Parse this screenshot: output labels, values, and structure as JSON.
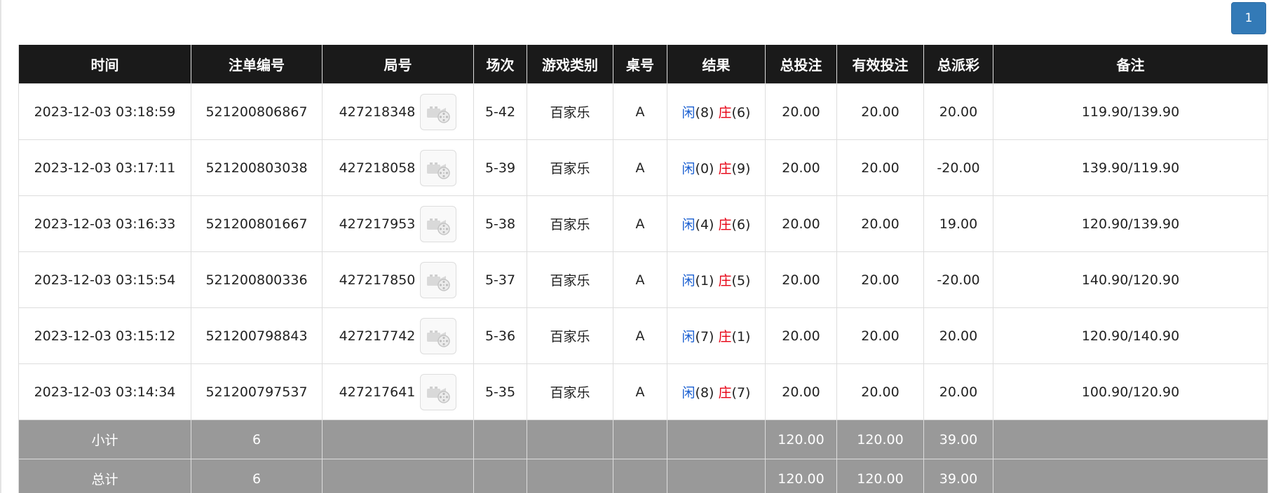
{
  "pagination": {
    "current_page": "1"
  },
  "table": {
    "headers": [
      "时间",
      "注单编号",
      "局号",
      "场次",
      "游戏类别",
      "桌号",
      "结果",
      "总投注",
      "有效投注",
      "总派彩",
      "备注"
    ],
    "rows": [
      {
        "time": "2023-12-03 03:18:59",
        "bet_id": "521200806867",
        "round_id": "427218348",
        "session": "5-42",
        "game": "百家乐",
        "table": "A",
        "player_label": "闲",
        "player_score": "(8)",
        "banker_label": "庄",
        "banker_score": "(6)",
        "total_bet": "20.00",
        "valid_bet": "20.00",
        "payout": "20.00",
        "payout_negative": false,
        "remark": "119.90/139.90"
      },
      {
        "time": "2023-12-03 03:17:11",
        "bet_id": "521200803038",
        "round_id": "427218058",
        "session": "5-39",
        "game": "百家乐",
        "table": "A",
        "player_label": "闲",
        "player_score": "(0)",
        "banker_label": "庄",
        "banker_score": "(9)",
        "total_bet": "20.00",
        "valid_bet": "20.00",
        "payout": "-20.00",
        "payout_negative": true,
        "remark": "139.90/119.90"
      },
      {
        "time": "2023-12-03 03:16:33",
        "bet_id": "521200801667",
        "round_id": "427217953",
        "session": "5-38",
        "game": "百家乐",
        "table": "A",
        "player_label": "闲",
        "player_score": "(4)",
        "banker_label": "庄",
        "banker_score": "(6)",
        "total_bet": "20.00",
        "valid_bet": "20.00",
        "payout": "19.00",
        "payout_negative": false,
        "remark": "120.90/139.90"
      },
      {
        "time": "2023-12-03 03:15:54",
        "bet_id": "521200800336",
        "round_id": "427217850",
        "session": "5-37",
        "game": "百家乐",
        "table": "A",
        "player_label": "闲",
        "player_score": "(1)",
        "banker_label": "庄",
        "banker_score": "(5)",
        "total_bet": "20.00",
        "valid_bet": "20.00",
        "payout": "-20.00",
        "payout_negative": true,
        "remark": "140.90/120.90"
      },
      {
        "time": "2023-12-03 03:15:12",
        "bet_id": "521200798843",
        "round_id": "427217742",
        "session": "5-36",
        "game": "百家乐",
        "table": "A",
        "player_label": "闲",
        "player_score": "(7)",
        "banker_label": "庄",
        "banker_score": "(1)",
        "total_bet": "20.00",
        "valid_bet": "20.00",
        "payout": "20.00",
        "payout_negative": false,
        "remark": "120.90/140.90"
      },
      {
        "time": "2023-12-03 03:14:34",
        "bet_id": "521200797537",
        "round_id": "427217641",
        "session": "5-35",
        "game": "百家乐",
        "table": "A",
        "player_label": "闲",
        "player_score": "(8)",
        "banker_label": "庄",
        "banker_score": "(7)",
        "total_bet": "20.00",
        "valid_bet": "20.00",
        "payout": "20.00",
        "payout_negative": false,
        "remark": "100.90/120.90"
      }
    ],
    "subtotal": {
      "label": "小计",
      "count": "6",
      "total_bet": "120.00",
      "valid_bet": "120.00",
      "payout": "39.00"
    },
    "grand_total": {
      "label": "总计",
      "count": "6",
      "total_bet": "120.00",
      "valid_bet": "120.00",
      "payout": "39.00"
    }
  },
  "icons": {
    "replay": "video-replay-icon"
  },
  "colors": {
    "header_bg": "#1a1a1a",
    "total_row_bg": "#999999",
    "player": "#1a5fd1",
    "banker": "#e60012",
    "loss": "#e60012",
    "bet": "#1a5fd1",
    "pager": "#337ab7"
  }
}
